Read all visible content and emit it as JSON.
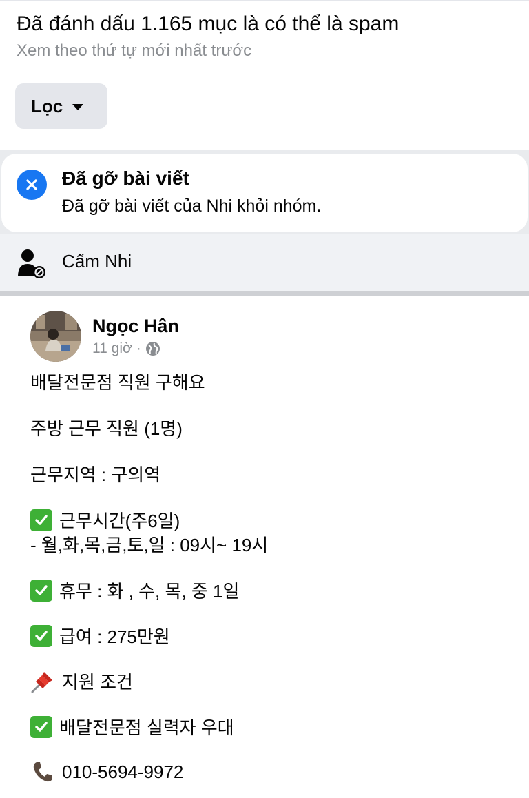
{
  "spam": {
    "title": "Đã đánh dấu 1.165 mục là có thể là spam",
    "subtitle": "Xem theo thứ tự mới nhất trước",
    "filter_label": "Lọc"
  },
  "removed": {
    "title": "Đã gỡ bài viết",
    "description": "Đã gỡ bài viết của Nhi khỏi nhóm."
  },
  "ban": {
    "label": "Cấm Nhi"
  },
  "post": {
    "author": "Ngọc Hân",
    "time": "11 giờ",
    "separator": "·",
    "lines": [
      "배달전문점 직원 구해요",
      "주방 근무 직원 (1명)",
      "근무지역 : 구의역",
      "근무시간(주6일)",
      "- 월,화,목,금,토,일 : 09시~ 19시",
      "휴무 : 화 , 수, 목, 중 1일",
      "급여 : 275만원",
      "지원 조건",
      "배달전문점 실력자 우대",
      "010-5694-9972"
    ]
  },
  "colors": {
    "accent_blue": "#1877f2",
    "check_green": "#3eb036",
    "muted_text": "#8a8d91"
  },
  "icons": [
    "caret-down-icon",
    "close-circle-icon",
    "ban-user-icon",
    "globe-icon",
    "check-mark-icon",
    "pushpin-icon",
    "phone-icon"
  ]
}
